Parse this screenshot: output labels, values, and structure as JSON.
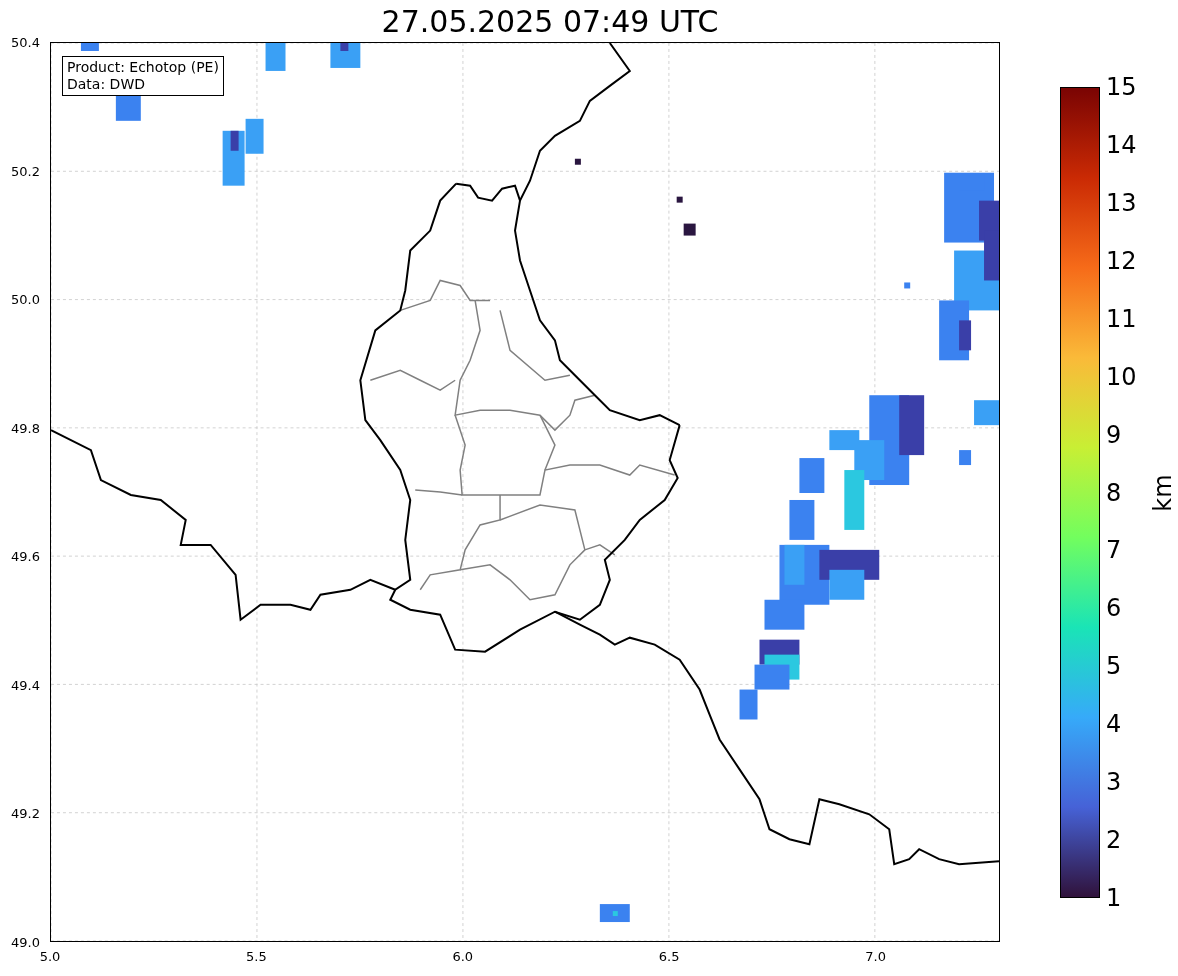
{
  "title": "27.05.2025 07:49 UTC",
  "annotation": [
    "Product: Echotop (PE)",
    "Data: DWD"
  ],
  "map": {
    "xticks": [
      "5.0",
      "5.5",
      "6.0",
      "6.5",
      "7.0"
    ],
    "yticks": [
      "50.4",
      "50.2",
      "50.0",
      "49.8",
      "49.6",
      "49.4",
      "49.2",
      "49.0"
    ]
  },
  "colorbar": {
    "ticks": [
      "15",
      "14",
      "13",
      "12",
      "11",
      "10",
      "9",
      "8",
      "7",
      "6",
      "5",
      "4",
      "3",
      "2",
      "1"
    ],
    "label": "km"
  }
}
